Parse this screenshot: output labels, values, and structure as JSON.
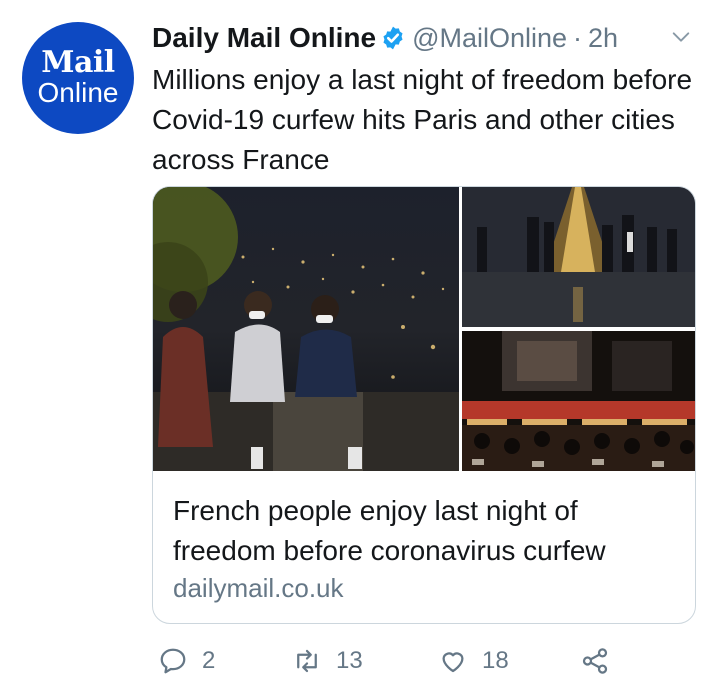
{
  "account": {
    "avatar_text_top": "Mail",
    "avatar_text_bottom": "Online",
    "display_name": "Daily Mail Online",
    "handle": "@MailOnline",
    "separator": "·",
    "timestamp": "2h",
    "brand_color": "#0d49c2",
    "verified_color": "#1da1f2"
  },
  "tweet": {
    "text": "Millions enjoy a last night of freedom before Covid-19 curfew hits Paris and other cities across France"
  },
  "card": {
    "title": "French people enjoy last night of freedom before coronavirus curfew",
    "domain": "dailymail.co.uk",
    "images": [
      "paris-night-three-people-masks",
      "eiffel-tower-night-crowd",
      "cafe-terrace-night"
    ]
  },
  "actions": {
    "reply_count": "2",
    "retweet_count": "13",
    "like_count": "18",
    "icons": [
      "reply-icon",
      "retweet-icon",
      "like-icon",
      "share-icon"
    ]
  }
}
